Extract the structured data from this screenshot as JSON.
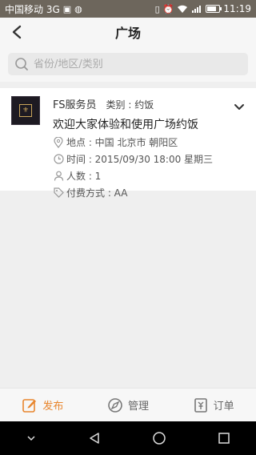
{
  "status_bar": {
    "carrier": "中国移动 3G",
    "time": "11:19",
    "battery_level": 0.75
  },
  "header": {
    "title": "广场",
    "back_icon": "chevron-left-icon"
  },
  "search": {
    "placeholder": "省份/地区/类别"
  },
  "post": {
    "author": "FS服务员",
    "category": "类别 : 约饭",
    "headline": "欢迎大家体验和使用广场约饭",
    "location": "地点 : 中国 北京市 朝阳区",
    "time": "时间 : 2015/09/30 18:00 星期三",
    "people": "人数 : 1",
    "payment": "付费方式 : AA"
  },
  "tabs": [
    {
      "label": "发布",
      "icon": "edit-icon",
      "active": true
    },
    {
      "label": "管理",
      "icon": "compass-icon",
      "active": false
    },
    {
      "label": "订单",
      "icon": "receipt-icon",
      "active": false
    }
  ],
  "colors": {
    "accent": "#e8862e",
    "status_bar": "#6d665c",
    "background": "#efefef"
  }
}
